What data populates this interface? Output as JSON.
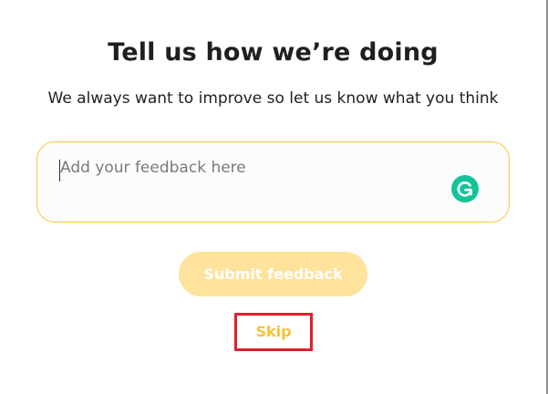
{
  "dialog": {
    "title": "Tell us how we’re doing",
    "subtitle": "We always want to improve so let us know what you think"
  },
  "feedback": {
    "placeholder": "Add your feedback here",
    "assistant_icon": "grammarly-icon"
  },
  "actions": {
    "submit_label": "Submit feedback",
    "skip_label": "Skip"
  },
  "colors": {
    "accent": "#f7c843",
    "submit_disabled": "#fde39b",
    "skip_text": "#f5c233",
    "highlight_border": "#e01f2d",
    "grammarly": "#15c39a"
  }
}
